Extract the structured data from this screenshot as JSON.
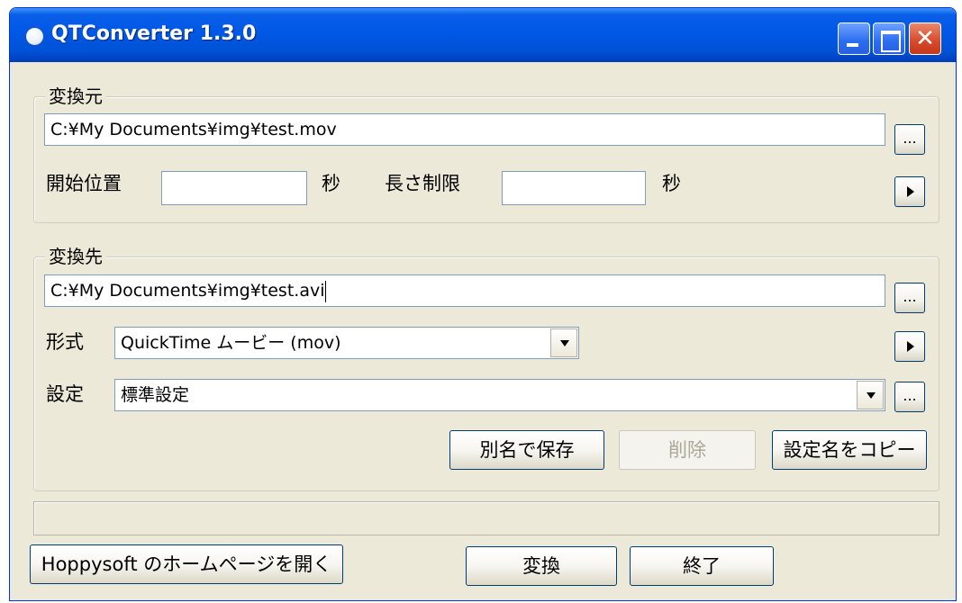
{
  "window": {
    "title": "QTConverter 1.3.0"
  },
  "source": {
    "group_label": "変換元",
    "path_value": "C:¥My Documents¥img¥test.mov",
    "browse_label": "...",
    "start_label": "開始位置",
    "start_value": "",
    "start_unit": "秒",
    "length_label": "長さ制限",
    "length_value": "",
    "length_unit": "秒"
  },
  "dest": {
    "group_label": "変換先",
    "path_value": "C:¥My Documents¥img¥test.avi",
    "browse_label": "...",
    "format_label": "形式",
    "format_value": "QuickTime ムービー (mov)",
    "settings_label": "設定",
    "settings_value": "標準設定",
    "settings_more_label": "...",
    "save_as_label": "別名で保存",
    "delete_label": "削除",
    "copy_name_label": "設定名をコピー"
  },
  "footer": {
    "homepage_label": "Hoppysoft のホームページを開く",
    "convert_label": "変換",
    "exit_label": "終了"
  },
  "icons": {
    "app": "app-icon",
    "minimize": "minimize-icon",
    "maximize": "maximize-icon",
    "close": "close-icon",
    "arrow": "play-arrow-icon",
    "dropdown": "chevron-down-icon"
  },
  "colors": {
    "titlebar": "#0058e6",
    "face": "#ece9d8",
    "close": "#d6492a"
  }
}
